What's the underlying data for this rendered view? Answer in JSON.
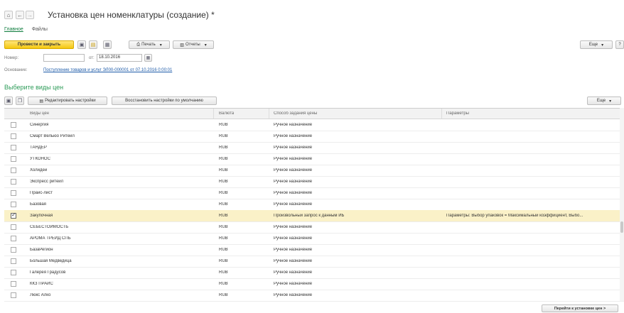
{
  "header": {
    "title": "Установка цен номенклатуры (создание) *",
    "home_icon": "home-icon",
    "back_icon": "arrow-left-icon",
    "forward_icon": "arrow-right-icon"
  },
  "tabs": [
    {
      "label": "Главное",
      "active": true
    },
    {
      "label": "Файлы",
      "active": false
    }
  ],
  "toolbar": {
    "post_close": "Провести и закрыть",
    "print": "Печать",
    "reports": "Отчеты",
    "more": "Еще",
    "help": "?"
  },
  "form": {
    "number_label": "Номер:",
    "number_value": "",
    "date_prefix": "от:",
    "date_value": "18.10.2016",
    "basis_label": "Основание:",
    "basis_link": "Поступление товаров и услуг ЭЛ00-000001 от 07.10.2016 0:00:01"
  },
  "section": {
    "title": "Выберите виды цен",
    "edit_settings": "Редактировать настройки",
    "restore_settings": "Восстановить настройки по умолчанию",
    "more": "Еще"
  },
  "table": {
    "columns": [
      "Виды цен",
      "Валюта",
      "Способ задания цены",
      "Параметры"
    ],
    "rows": [
      {
        "checked": false,
        "name": "Синергия",
        "currency": "RUB",
        "method": "Ручное назначение",
        "params": ""
      },
      {
        "checked": false,
        "name": "Смарт Вельюо Ритейл",
        "currency": "RUB",
        "method": "Ручное назначение",
        "params": ""
      },
      {
        "checked": false,
        "name": "ТАНДЕР",
        "currency": "RUB",
        "method": "Ручное назначение",
        "params": ""
      },
      {
        "checked": false,
        "name": "УТКОНОС",
        "currency": "RUB",
        "method": "Ручное назначение",
        "params": ""
      },
      {
        "checked": false,
        "name": "Холидей",
        "currency": "RUB",
        "method": "Ручное назначение",
        "params": ""
      },
      {
        "checked": false,
        "name": "Экспресс ритейл",
        "currency": "RUB",
        "method": "Ручное назначение",
        "params": ""
      },
      {
        "checked": false,
        "name": "Прайс-лист",
        "currency": "RUB",
        "method": "Ручное назначение",
        "params": ""
      },
      {
        "checked": false,
        "name": "Базовая",
        "currency": "RUB",
        "method": "Ручное назначение",
        "params": ""
      },
      {
        "checked": true,
        "name": "Закупочная",
        "currency": "RUB",
        "method": "Произвольный запрос к данным ИБ",
        "params": "Параметры: Выбор упаковок = Максимальный коэффициент, Выбо..."
      },
      {
        "checked": false,
        "name": "СЕБЕСТОИМОСТЬ",
        "currency": "RUB",
        "method": "Ручное назначение",
        "params": ""
      },
      {
        "checked": false,
        "name": "АРОМА ТРЕЙД СПБ",
        "currency": "RUB",
        "method": "Ручное назначение",
        "params": ""
      },
      {
        "checked": false,
        "name": "БазаРегион",
        "currency": "RUB",
        "method": "Ручное назначение",
        "params": ""
      },
      {
        "checked": false,
        "name": "Большая Медведица",
        "currency": "RUB",
        "method": "Ручное назначение",
        "params": ""
      },
      {
        "checked": false,
        "name": "Галерея Градусов",
        "currency": "RUB",
        "method": "Ручное назначение",
        "params": ""
      },
      {
        "checked": false,
        "name": "ККЗ ПРАЙС",
        "currency": "RUB",
        "method": "Ручное назначение",
        "params": ""
      },
      {
        "checked": false,
        "name": "Люкс Алко",
        "currency": "RUB",
        "method": "Ручное назначение",
        "params": ""
      }
    ]
  },
  "footer": {
    "goto_button": "Перейти к установке цен >"
  },
  "colors": {
    "accent_green": "#2e9c59",
    "primary_yellow": "#f5c70e",
    "link_blue": "#1c5aa8",
    "selected_row": "#faf1c8"
  }
}
